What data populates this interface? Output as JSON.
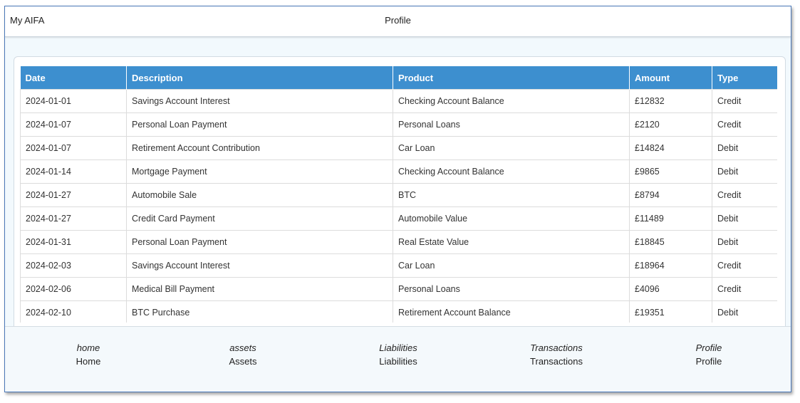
{
  "header": {
    "app_name": "My AIFA",
    "page_title": "Profile"
  },
  "table": {
    "columns": [
      "Date",
      "Description",
      "Product",
      "Amount",
      "Type"
    ],
    "rows": [
      [
        "2024-01-01",
        "Savings Account Interest",
        "Checking Account Balance",
        "£12832",
        "Credit"
      ],
      [
        "2024-01-07",
        "Personal Loan Payment",
        "Personal Loans",
        "£2120",
        "Credit"
      ],
      [
        "2024-01-07",
        "Retirement Account Contribution",
        "Car Loan",
        "£14824",
        "Debit"
      ],
      [
        "2024-01-14",
        "Mortgage Payment",
        "Checking Account Balance",
        "£9865",
        "Debit"
      ],
      [
        "2024-01-27",
        "Automobile Sale",
        "BTC",
        "£8794",
        "Credit"
      ],
      [
        "2024-01-27",
        "Credit Card Payment",
        "Automobile Value",
        "£11489",
        "Debit"
      ],
      [
        "2024-01-31",
        "Personal Loan Payment",
        "Real Estate Value",
        "£18845",
        "Debit"
      ],
      [
        "2024-02-03",
        "Savings Account Interest",
        "Car Loan",
        "£18964",
        "Credit"
      ],
      [
        "2024-02-06",
        "Medical Bill Payment",
        "Personal Loans",
        "£4096",
        "Credit"
      ],
      [
        "2024-02-10",
        "BTC Purchase",
        "Retirement Account Balance",
        "£19351",
        "Debit"
      ]
    ]
  },
  "nav": {
    "items": [
      {
        "icon_label": "home",
        "label": "Home"
      },
      {
        "icon_label": "assets",
        "label": "Assets"
      },
      {
        "icon_label": "Liabilities",
        "label": "Liabilities"
      },
      {
        "icon_label": "Transactions",
        "label": "Transactions"
      },
      {
        "icon_label": "Profile",
        "label": "Profile"
      }
    ]
  }
}
